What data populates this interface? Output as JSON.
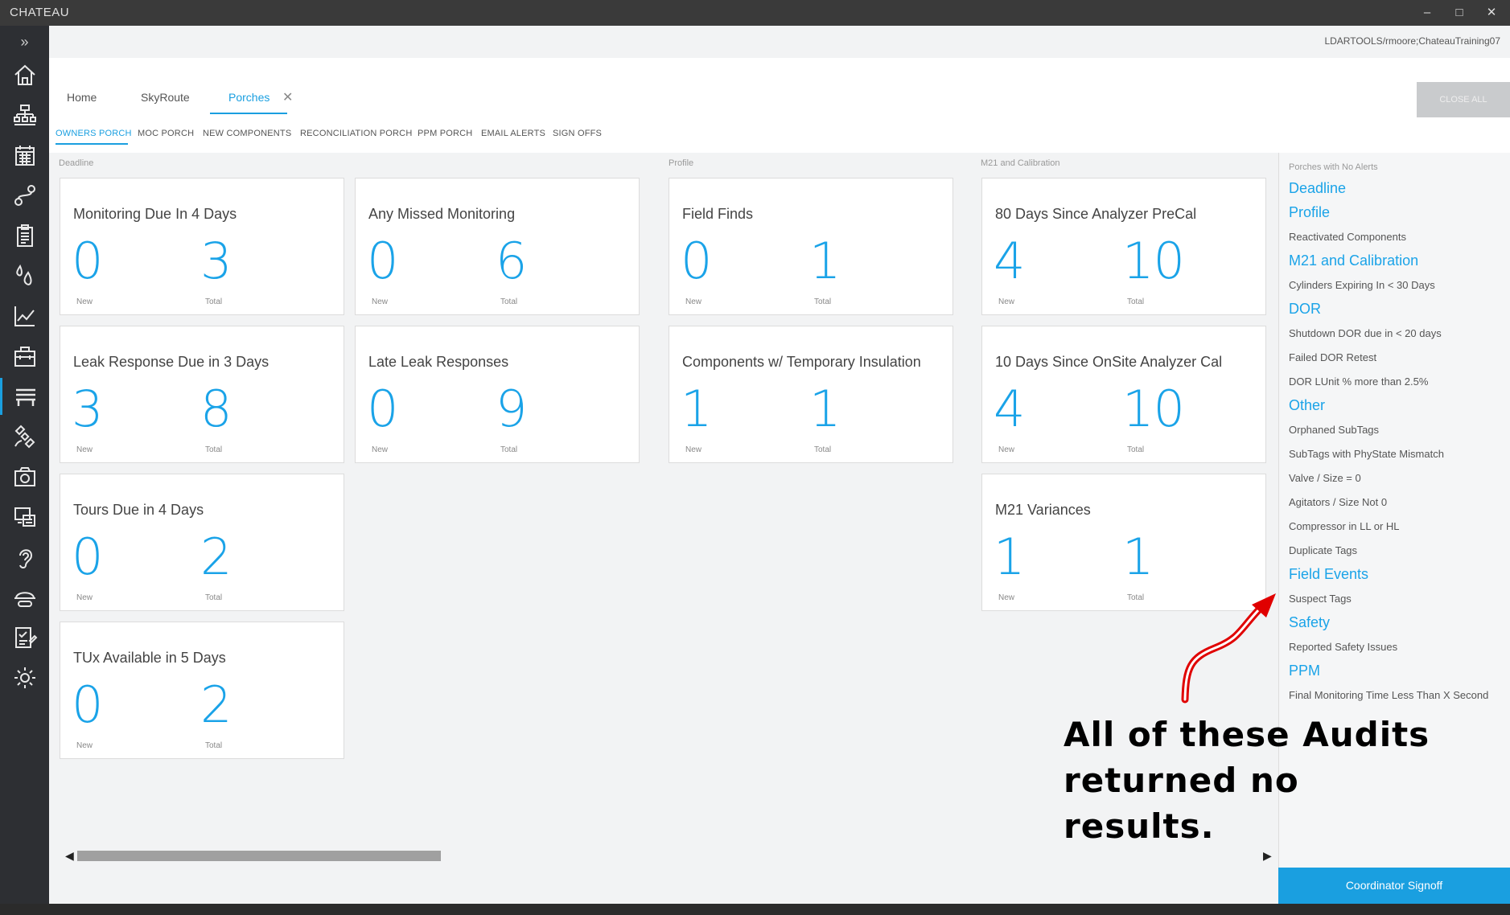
{
  "window": {
    "title": "CHATEAU",
    "minimize": "–",
    "maximize": "□",
    "close": "✕"
  },
  "nav": {
    "expand": "»",
    "items": [
      "home-icon",
      "hierarchy-icon",
      "calendar-icon",
      "route-icon",
      "clipboard-icon",
      "droplets-icon",
      "chart-icon",
      "toolbox-icon",
      "bench-icon",
      "satellite-icon",
      "camera-icon",
      "monitor-icon",
      "ear-icon",
      "hardhat-icon",
      "checklist-icon",
      "settings-icon"
    ]
  },
  "header": {
    "user": "LDARTOOLS/rmoore;ChateauTraining07"
  },
  "tabs": {
    "home": "Home",
    "skyroute": "SkyRoute",
    "porches": "Porches",
    "close": "✕",
    "close_all": "CLOSE ALL"
  },
  "subtabs": [
    "OWNERS PORCH",
    "MOC PORCH",
    "NEW COMPONENTS",
    "RECONCILIATION PORCH",
    "PPM PORCH",
    "EMAIL ALERTS",
    "SIGN OFFS"
  ],
  "sections": {
    "deadline": "Deadline",
    "profile": "Profile",
    "m21": "M21 and Calibration"
  },
  "cards": [
    {
      "title": "Monitoring Due In 4 Days",
      "new": "0",
      "total": "3",
      "new_label": "New",
      "total_label": "Total"
    },
    {
      "title": "Any Missed Monitoring",
      "new": "0",
      "total": "6",
      "new_label": "New",
      "total_label": "Total"
    },
    {
      "title": "Field Finds",
      "new": "0",
      "total": "1",
      "new_label": "New",
      "total_label": "Total"
    },
    {
      "title": "80 Days Since Analyzer PreCal",
      "new": "4",
      "total": "10",
      "new_label": "New",
      "total_label": "Total"
    },
    {
      "title": "Leak Response Due in 3 Days",
      "new": "3",
      "total": "8",
      "new_label": "New",
      "total_label": "Total"
    },
    {
      "title": "Late Leak Responses",
      "new": "0",
      "total": "9",
      "new_label": "New",
      "total_label": "Total"
    },
    {
      "title": "Components w/ Temporary Insulation",
      "new": "1",
      "total": "1",
      "new_label": "New",
      "total_label": "Total"
    },
    {
      "title": "10 Days Since OnSite Analyzer Cal",
      "new": "4",
      "total": "10",
      "new_label": "New",
      "total_label": "Total"
    },
    {
      "title": "Tours Due in 4 Days",
      "new": "0",
      "total": "2",
      "new_label": "New",
      "total_label": "Total"
    },
    {
      "title": "M21 Variances",
      "new": "1",
      "total": "1",
      "new_label": "New",
      "total_label": "Total"
    },
    {
      "title": "TUx Available in 5 Days",
      "new": "0",
      "total": "2",
      "new_label": "New",
      "total_label": "Total"
    }
  ],
  "no_alerts": {
    "heading": "Porches with No Alerts",
    "items": [
      {
        "text": "Deadline",
        "kind": "cat"
      },
      {
        "text": "Profile",
        "kind": "cat"
      },
      {
        "text": "Reactivated Components",
        "kind": "sub"
      },
      {
        "text": "M21 and Calibration",
        "kind": "cat"
      },
      {
        "text": "Cylinders Expiring In < 30 Days",
        "kind": "sub"
      },
      {
        "text": "DOR",
        "kind": "cat"
      },
      {
        "text": "Shutdown DOR due in < 20 days",
        "kind": "sub"
      },
      {
        "text": "Failed DOR Retest",
        "kind": "sub"
      },
      {
        "text": "DOR LUnit % more than 2.5%",
        "kind": "sub"
      },
      {
        "text": "Other",
        "kind": "cat"
      },
      {
        "text": "Orphaned SubTags",
        "kind": "sub"
      },
      {
        "text": "SubTags with PhyState Mismatch",
        "kind": "sub"
      },
      {
        "text": "Valve / Size = 0",
        "kind": "sub"
      },
      {
        "text": "Agitators / Size Not 0",
        "kind": "sub"
      },
      {
        "text": "Compressor in LL or HL",
        "kind": "sub"
      },
      {
        "text": "Duplicate Tags",
        "kind": "sub"
      },
      {
        "text": "Field Events",
        "kind": "cat"
      },
      {
        "text": "Suspect Tags",
        "kind": "sub"
      },
      {
        "text": "Safety",
        "kind": "cat"
      },
      {
        "text": "Reported Safety Issues",
        "kind": "sub"
      },
      {
        "text": "PPM",
        "kind": "cat"
      },
      {
        "text": "Final Monitoring Time Less Than X Second",
        "kind": "sub"
      }
    ],
    "signoff": "Coordinator Signoff"
  },
  "scroll": {
    "left": "◀",
    "right": "▶"
  },
  "annotation": {
    "line1": "All of these Audits",
    "line2": "returned no",
    "line3": "results.",
    "arrow_color": "#e00000"
  },
  "colors": {
    "accent": "#1a9fe0",
    "nav_bg": "#2d2f33"
  }
}
